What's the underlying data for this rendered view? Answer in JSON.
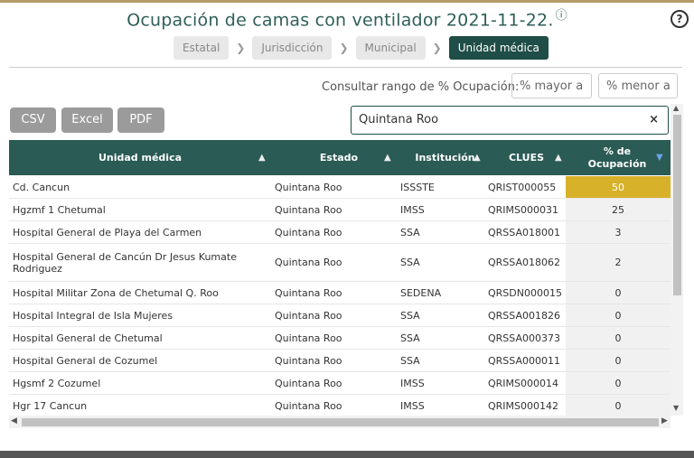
{
  "title": "Ocupación de camas con ventilador 2021-11-22.",
  "breadcrumbs": [
    "Estatal",
    "Jurisdicción",
    "Municipal",
    "Unidad médica"
  ],
  "range": {
    "label": "Consultar rango de % Ocupación:",
    "min_placeholder": "% mayor a",
    "max_placeholder": "% menor a"
  },
  "export_buttons": [
    "CSV",
    "Excel",
    "PDF"
  ],
  "search": {
    "value": "Quintana Roo",
    "clear": "×"
  },
  "icons": {
    "help": "?",
    "info": "ⓘ"
  },
  "table": {
    "columns": [
      "Unidad médica",
      "Estado",
      "Institución",
      "CLUES",
      "% de Ocupación"
    ],
    "rows": [
      [
        "Cd. Cancun",
        "Quintana Roo",
        "ISSSTE",
        "QRIST000055",
        "50"
      ],
      [
        "Hgzmf 1 Chetumal",
        "Quintana Roo",
        "IMSS",
        "QRIMS000031",
        "25"
      ],
      [
        "Hospital General de Playa del Carmen",
        "Quintana Roo",
        "SSA",
        "QRSSA018001",
        "3"
      ],
      [
        "Hospital General de Cancún Dr Jesus Kumate Rodriguez",
        "Quintana Roo",
        "SSA",
        "QRSSA018062",
        "2"
      ],
      [
        "Hospital Militar Zona de Chetumal Q. Roo",
        "Quintana Roo",
        "SEDENA",
        "QRSDN000015",
        "0"
      ],
      [
        "Hospital Integral de Isla Mujeres",
        "Quintana Roo",
        "SSA",
        "QRSSA001826",
        "0"
      ],
      [
        "Hospital General de Chetumal",
        "Quintana Roo",
        "SSA",
        "QRSSA000373",
        "0"
      ],
      [
        "Hospital General de Cozumel",
        "Quintana Roo",
        "SSA",
        "QRSSA000011",
        "0"
      ],
      [
        "Hgsmf 2 Cozumel",
        "Quintana Roo",
        "IMSS",
        "QRIMS000014",
        "0"
      ],
      [
        "Hgr 17 Cancun",
        "Quintana Roo",
        "IMSS",
        "QRIMS000142",
        "0"
      ]
    ]
  },
  "colors": {
    "header_bg": "#2a5b54",
    "active_crumb": "#1f4d47",
    "highlight": "#d8b12a",
    "pct_cell_bg": "#f1f1f1"
  }
}
